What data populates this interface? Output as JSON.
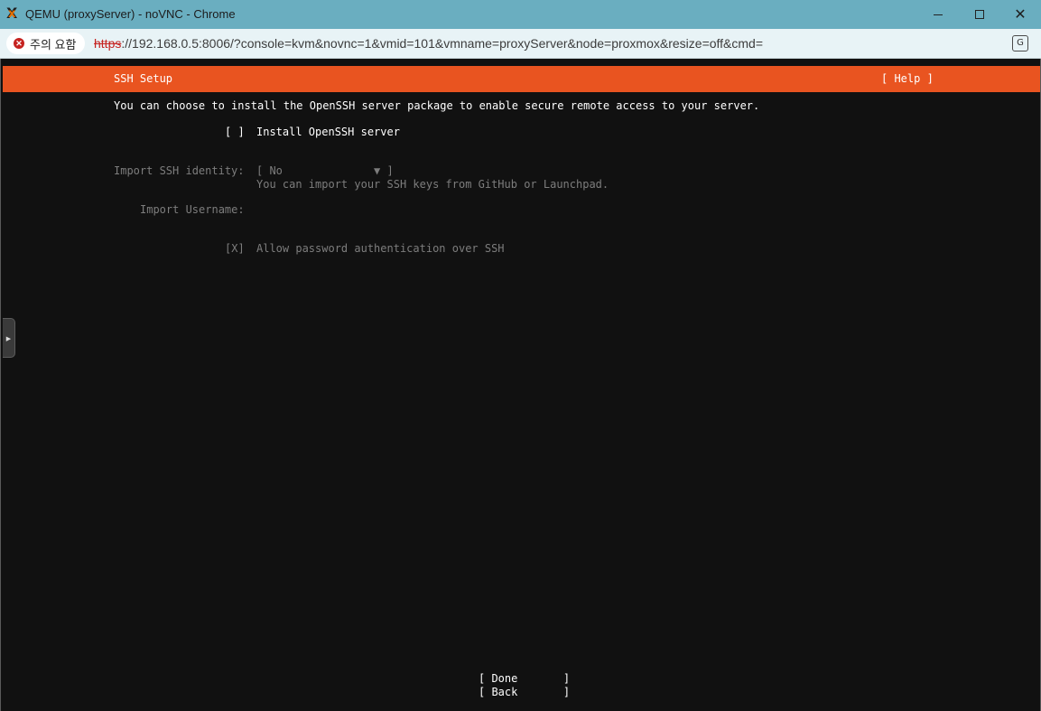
{
  "window": {
    "title": "QEMU (proxyServer) - noVNC - Chrome",
    "close_glyph": "✕"
  },
  "addressbar": {
    "warning_label": "주의 요함",
    "url_scheme": "https",
    "url_rest": "://192.168.0.5:8006/?console=kvm&novnc=1&vmid=101&vmname=proxyServer&node=proxmox&resize=off&cmd="
  },
  "installer": {
    "header_title": "SSH Setup",
    "help_button": "[ Help ]",
    "intro": "You can choose to install the OpenSSH server package to enable secure remote access to your server.",
    "install_checkbox": "[ ]",
    "install_label": "Install OpenSSH server",
    "import_identity_label": "Import SSH identity:",
    "import_identity_value": "[ No              ▼ ]",
    "import_identity_help": "You can import your SSH keys from GitHub or Launchpad.",
    "import_username_label": "Import Username:",
    "password_checkbox": "[X]",
    "password_label": "Allow password authentication over SSH",
    "done_button": "[ Done       ]",
    "back_button": "[ Back       ]"
  },
  "icons": {
    "app": "proxmox-x-icon",
    "warning": "warning-circle-icon",
    "translate": "translate-icon",
    "side_handle": "expand-arrow-icon"
  },
  "colors": {
    "titlebar": "#6aaec0",
    "accent": "#e95420",
    "terminal_bg": "#111111"
  }
}
